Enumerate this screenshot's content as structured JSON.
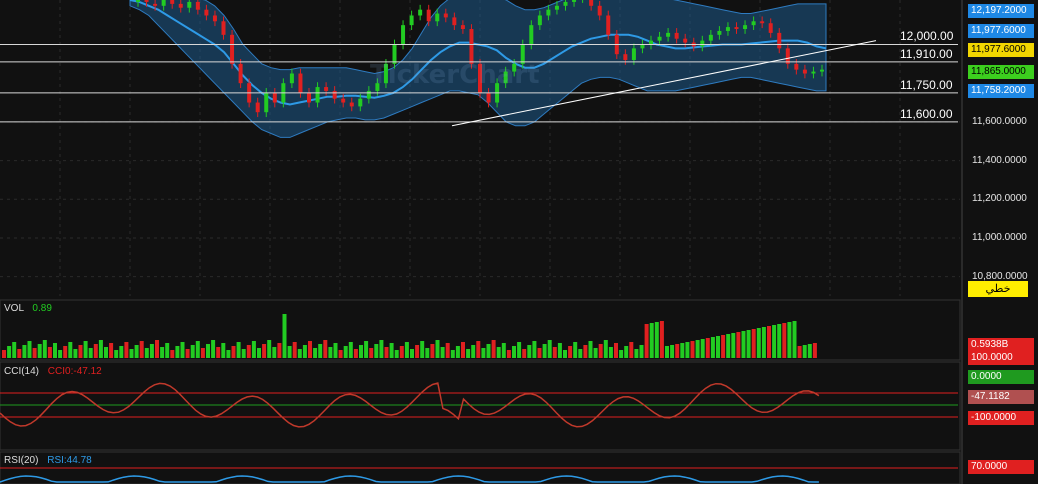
{
  "chart_data": {
    "type": "candlestick",
    "watermark": "TickerChart",
    "price_axis": {
      "ticks": [
        "11,600.0000",
        "11,400.0000",
        "11,200.0000",
        "11,000.0000",
        "10,800.0000"
      ],
      "ylim": [
        10700,
        12230
      ]
    },
    "price_tags": [
      {
        "text": "12,197.2000",
        "bg": "#1e88e5",
        "fg": "#ffffff"
      },
      {
        "text": "11,977.6000",
        "bg": "#1e88e5",
        "fg": "#ffffff"
      },
      {
        "text": "11,977.6000",
        "bg": "#f2d600",
        "fg": "#000000"
      },
      {
        "text": "11,865.0000",
        "bg": "#3ccf1e",
        "fg": "#000000"
      },
      {
        "text": "11,758.2000",
        "bg": "#1e88e5",
        "fg": "#ffffff"
      }
    ],
    "horizontal_levels": [
      {
        "label": "12,000.00",
        "value": 12000
      },
      {
        "label": "11,910.00",
        "value": 11910
      },
      {
        "label": "11,750.00",
        "value": 11750
      },
      {
        "label": "11,600.00",
        "value": 11600
      }
    ],
    "drawing_type_label": "خطي",
    "candles_close": [
      12240,
      12220,
      12200,
      12230,
      12210,
      12190,
      12220,
      12180,
      12150,
      12120,
      12050,
      11900,
      11800,
      11700,
      11650,
      11750,
      11700,
      11800,
      11850,
      11750,
      11700,
      11780,
      11760,
      11720,
      11700,
      11680,
      11720,
      11760,
      11800,
      11900,
      12000,
      12100,
      12150,
      12180,
      12120,
      12160,
      12140,
      12100,
      12080,
      11900,
      11750,
      11700,
      11800,
      11860,
      11900,
      12000,
      12100,
      12150,
      12180,
      12200,
      12220,
      12240,
      12250,
      12200,
      12150,
      12050,
      11950,
      11920,
      11980,
      12000,
      12020,
      12040,
      12060,
      12030,
      12010,
      11990,
      12020,
      12050,
      12070,
      12090,
      12080,
      12100,
      12120,
      12110,
      12060,
      11980,
      11900,
      11870,
      11850,
      11860,
      11870
    ],
    "candles_open": [
      12220,
      12240,
      12210,
      12200,
      12230,
      12210,
      12190,
      12220,
      12180,
      12150,
      12120,
      12050,
      11900,
      11800,
      11700,
      11650,
      11750,
      11700,
      11800,
      11850,
      11750,
      11700,
      11780,
      11760,
      11720,
      11700,
      11680,
      11720,
      11760,
      11800,
      11900,
      12000,
      12100,
      12150,
      12180,
      12120,
      12160,
      12140,
      12100,
      12080,
      11900,
      11750,
      11700,
      11800,
      11860,
      11900,
      12000,
      12100,
      12150,
      12180,
      12200,
      12220,
      12240,
      12250,
      12200,
      12150,
      12050,
      11950,
      11920,
      11980,
      12000,
      12020,
      12040,
      12060,
      12030,
      12010,
      11990,
      12020,
      12050,
      12070,
      12090,
      12080,
      12100,
      12120,
      12110,
      12060,
      11980,
      11900,
      11870,
      11850,
      11860
    ],
    "bollinger": {
      "upper": [
        12250,
        12250,
        12250,
        12250,
        12250,
        12250,
        12250,
        12240,
        12230,
        12200,
        12150,
        12080,
        12000,
        11950,
        11900,
        11880,
        11870,
        11870,
        11880,
        11880,
        11880,
        11880,
        11880,
        11880,
        11870,
        11860,
        11850,
        11860,
        11880,
        11920,
        11980,
        12060,
        12140,
        12200,
        12240,
        12250,
        12250,
        12250,
        12250,
        12250,
        12230,
        12200,
        12180,
        12180,
        12190,
        12210,
        12230,
        12250,
        12250,
        12250,
        12250,
        12250,
        12250,
        12250,
        12250,
        12250,
        12250,
        12240,
        12230,
        12220,
        12210,
        12200,
        12190,
        12180,
        12170,
        12160,
        12160,
        12170,
        12180,
        12190,
        12200,
        12210,
        12210,
        12210,
        12210
      ],
      "lower": [
        12200,
        12180,
        12150,
        12100,
        12050,
        12000,
        11950,
        11900,
        11850,
        11800,
        11750,
        11700,
        11650,
        11600,
        11560,
        11540,
        11520,
        11520,
        11540,
        11560,
        11580,
        11600,
        11610,
        11620,
        11620,
        11610,
        11610,
        11620,
        11640,
        11660,
        11680,
        11700,
        11720,
        11740,
        11760,
        11760,
        11750,
        11740,
        11700,
        11650,
        11600,
        11580,
        11580,
        11600,
        11640,
        11680,
        11720,
        11760,
        11800,
        11820,
        11830,
        11830,
        11820,
        11800,
        11780,
        11760,
        11760,
        11760,
        11760,
        11770,
        11780,
        11790,
        11800,
        11810,
        11820,
        11830,
        11830,
        11820,
        11810,
        11800,
        11790,
        11780,
        11770,
        11760,
        11760
      ],
      "middle": [
        12230,
        12220,
        12200,
        12180,
        12150,
        12120,
        12090,
        12060,
        12030,
        12000,
        11960,
        11900,
        11840,
        11790,
        11750,
        11720,
        11700,
        11690,
        11700,
        11710,
        11720,
        11730,
        11730,
        11735,
        11735,
        11730,
        11725,
        11735,
        11750,
        11780,
        11820,
        11870,
        11920,
        11960,
        11990,
        12010,
        12010,
        12000,
        11990,
        11970,
        11930,
        11900,
        11880,
        11880,
        11900,
        11930,
        11960,
        11990,
        12010,
        12030,
        12040,
        12050,
        12050,
        12050,
        12040,
        12020,
        12000,
        11990,
        11980,
        11980,
        11985,
        11990,
        11995,
        12000,
        12000,
        12000,
        12005,
        12010,
        12015,
        12020,
        12020,
        12020,
        12010,
        11990,
        11980
      ]
    },
    "volume": {
      "label": "VOL",
      "value_text": "0.89",
      "tags": [
        {
          "text": "0.5938B",
          "bg": "#e02020"
        },
        {
          "text": "100.0000",
          "bg": "#e02020"
        }
      ]
    },
    "cci": {
      "label": "CCI(14)",
      "value_text": "CCI0:-47.12",
      "tags": [
        {
          "text": "0.0000",
          "bg": "#1f9a1f"
        },
        {
          "text": "-47.1182",
          "bg": "#b05050"
        },
        {
          "text": "-100.0000",
          "bg": "#e02020"
        }
      ]
    },
    "rsi": {
      "label": "RSI(20)",
      "value_text": "RSI:44.78",
      "tags": [
        {
          "text": "70.0000",
          "bg": "#e02020"
        }
      ]
    },
    "colors": {
      "up": "#22cc22",
      "down": "#e02020",
      "band": "#1e5a8a",
      "mid": "#2e9ae6"
    }
  }
}
